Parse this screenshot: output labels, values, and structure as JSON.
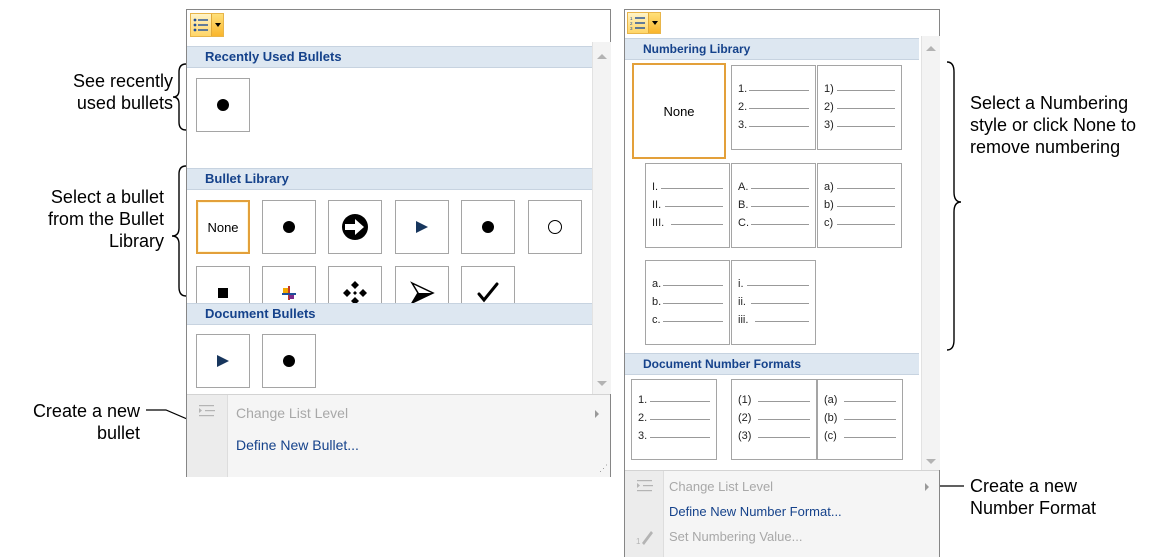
{
  "bullets_panel": {
    "sections": {
      "recent": "Recently Used Bullets",
      "library": "Bullet Library",
      "document": "Document Bullets"
    },
    "library_none_label": "None",
    "menu": {
      "change_level": "Change List Level",
      "define_new": "Define New Bullet..."
    }
  },
  "numbering_panel": {
    "sections": {
      "library": "Numbering Library",
      "document": "Document Number Formats"
    },
    "none_label": "None",
    "library_tiles": [
      [
        "1.",
        "2.",
        "3."
      ],
      [
        "1)",
        "2)",
        "3)"
      ],
      [
        "I.",
        "II.",
        "III."
      ],
      [
        "A.",
        "B.",
        "C."
      ],
      [
        "a)",
        "b)",
        "c)"
      ],
      [
        "a.",
        "b.",
        "c."
      ],
      [
        "i.",
        "ii.",
        "iii."
      ]
    ],
    "document_tiles": [
      [
        "1.",
        "2.",
        "3."
      ],
      [
        "(1)",
        "(2)",
        "(3)"
      ],
      [
        "(a)",
        "(b)",
        "(c)"
      ]
    ],
    "menu": {
      "change_level": "Change List Level",
      "define_new": "Define New Number Format...",
      "set_value": "Set Numbering Value..."
    }
  },
  "annotations": {
    "recent": [
      "See recently",
      "used bullets"
    ],
    "library": [
      "Select a bullet",
      "from the Bullet",
      "Library"
    ],
    "new_bullet": [
      "Create a new",
      "bullet"
    ],
    "numbering": [
      "Select a Numbering",
      "style or click None to",
      "remove numbering"
    ],
    "new_number": [
      "Create a new",
      "Number Format"
    ]
  },
  "colors": {
    "section_header_bg": "#dde7f1",
    "section_header_text": "#15428b",
    "selection_border": "#e3a03a",
    "menu_link": "#15428b",
    "disabled": "#a8a8a8"
  }
}
